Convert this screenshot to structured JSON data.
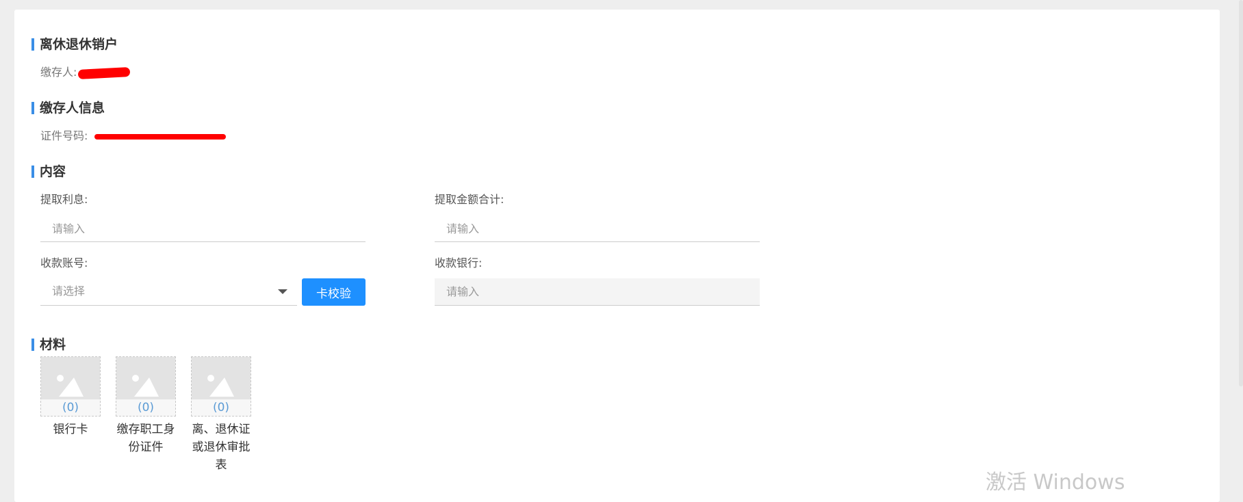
{
  "sections": {
    "retire_close": {
      "title": "离休退休销户",
      "depositor_label": "缴存人:"
    },
    "depositor_info": {
      "title": "缴存人信息",
      "id_label": "证件号码:"
    },
    "content": {
      "title": "内容",
      "interest": {
        "label": "提取利息:",
        "placeholder": "请输入"
      },
      "total_amount": {
        "label": "提取金额合计:",
        "placeholder": "请输入"
      },
      "account": {
        "label": "收款账号:",
        "placeholder": "请选择",
        "verify_button": "卡校验"
      },
      "bank": {
        "label": "收款银行:",
        "placeholder": "请输入"
      }
    },
    "materials": {
      "title": "材料",
      "items": [
        {
          "count": "(0)",
          "label": "银行卡"
        },
        {
          "count": "(0)",
          "label": "缴存职工身份证件"
        },
        {
          "count": "(0)",
          "label": "离、退休证或退休审批表"
        }
      ]
    }
  },
  "watermark": "激活 Windows",
  "colors": {
    "accent": "#3a8ee6",
    "button": "#1e90ff",
    "redaction": "#ff0000"
  }
}
